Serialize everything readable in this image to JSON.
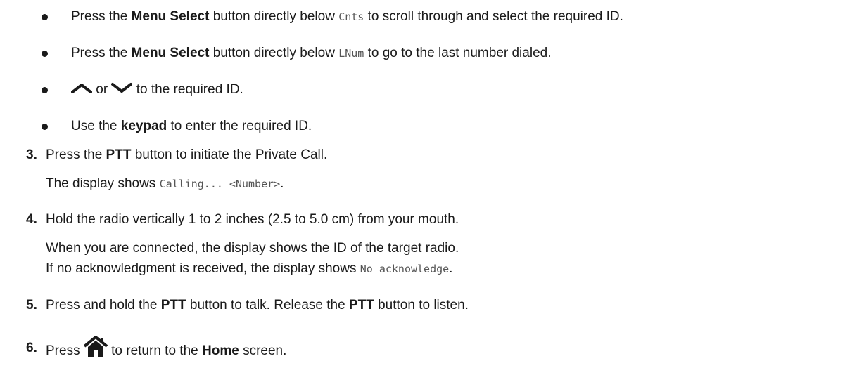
{
  "bullets": [
    {
      "pre": "Press the ",
      "bold": "Menu Select",
      "mid": " button directly below ",
      "code": "Cnts",
      "post": " to scroll through and select the required ID."
    },
    {
      "pre": "Press the ",
      "bold": "Menu Select",
      "mid": " button directly below ",
      "code": "LNum",
      "post": " to go to the last number dialed."
    },
    {
      "or": " or ",
      "post": " to the required ID.",
      "icon_up": "chevron-up-icon",
      "icon_down": "chevron-down-icon"
    },
    {
      "pre": "Use the ",
      "bold": "keypad",
      "post": " to enter the required ID."
    }
  ],
  "steps": [
    {
      "num": "3.",
      "pre": "Press the ",
      "bold": "PTT",
      "post": " button to initiate the Private Call.",
      "note_pre": "The display shows ",
      "note_code": "Calling... <Number>",
      "note_post": "."
    },
    {
      "num": "4.",
      "text": "Hold the radio vertically 1 to 2 inches (2.5 to 5.0 cm) from your mouth.",
      "line2": "When you are connected, the display shows the ID of the target radio.",
      "line3_pre": "If no acknowledgment is received, the display shows ",
      "line3_code": "No acknowledge",
      "line3_post": "."
    },
    {
      "num": "5.",
      "pre": "Press and hold the ",
      "bold1": "PTT",
      "mid": " button to talk. Release the ",
      "bold2": "PTT",
      "post": " button to listen."
    },
    {
      "num": "6.",
      "pre": "Press ",
      "icon": "home-icon",
      "mid": " to return to the ",
      "bold": "Home",
      "post": " screen."
    }
  ]
}
